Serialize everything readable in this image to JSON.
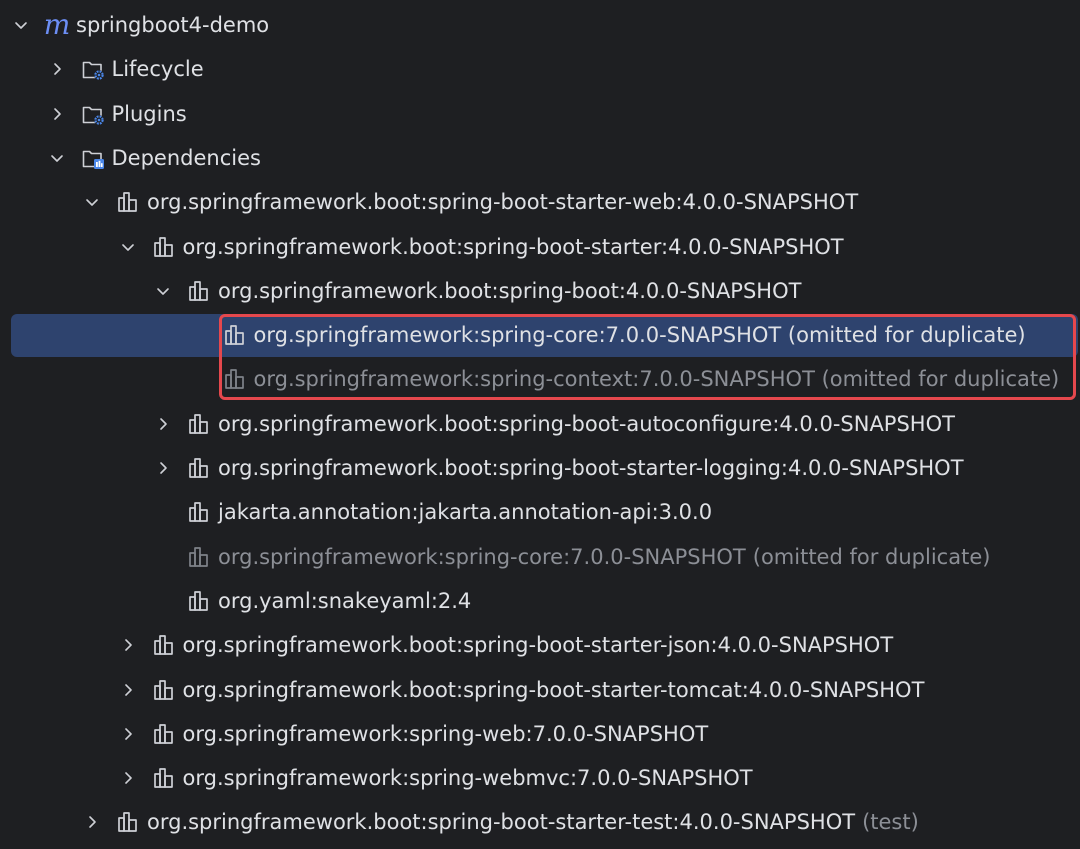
{
  "tree": [
    {
      "id": "root",
      "depth": 0,
      "arrow": "expanded",
      "icon": "maven-module-icon",
      "text": "springboot4-demo",
      "suffix": "",
      "dim": false,
      "selected": false
    },
    {
      "id": "lifecycle",
      "depth": 1,
      "arrow": "collapsed",
      "icon": "lifecycle-folder-icon",
      "text": "Lifecycle",
      "suffix": "",
      "dim": false,
      "selected": false
    },
    {
      "id": "plugins",
      "depth": 1,
      "arrow": "collapsed",
      "icon": "plugins-folder-icon",
      "text": "Plugins",
      "suffix": "",
      "dim": false,
      "selected": false
    },
    {
      "id": "dependencies",
      "depth": 1,
      "arrow": "expanded",
      "icon": "dependencies-folder-icon",
      "text": "Dependencies",
      "suffix": "",
      "dim": false,
      "selected": false
    },
    {
      "id": "starter-web",
      "depth": 2,
      "arrow": "expanded",
      "icon": "library-icon",
      "text": "org.springframework.boot:spring-boot-starter-web:4.0.0-SNAPSHOT",
      "suffix": "",
      "dim": false,
      "selected": false
    },
    {
      "id": "starter",
      "depth": 3,
      "arrow": "expanded",
      "icon": "library-icon",
      "text": "org.springframework.boot:spring-boot-starter:4.0.0-SNAPSHOT",
      "suffix": "",
      "dim": false,
      "selected": false
    },
    {
      "id": "boot",
      "depth": 4,
      "arrow": "expanded",
      "icon": "library-icon",
      "text": "org.springframework.boot:spring-boot:4.0.0-SNAPSHOT",
      "suffix": "",
      "dim": false,
      "selected": false
    },
    {
      "id": "core-dup",
      "depth": 5,
      "arrow": "none",
      "icon": "library-icon",
      "text": "org.springframework:spring-core:7.0.0-SNAPSHOT (omitted for duplicate)",
      "suffix": "",
      "dim": false,
      "selected": true
    },
    {
      "id": "context-dup",
      "depth": 5,
      "arrow": "none",
      "icon": "library-icon",
      "text": "org.springframework:spring-context:7.0.0-SNAPSHOT (omitted for duplicate)",
      "suffix": "",
      "dim": true,
      "selected": false
    },
    {
      "id": "autoconfigure",
      "depth": 4,
      "arrow": "collapsed",
      "icon": "library-icon",
      "text": "org.springframework.boot:spring-boot-autoconfigure:4.0.0-SNAPSHOT",
      "suffix": "",
      "dim": false,
      "selected": false
    },
    {
      "id": "starter-logging",
      "depth": 4,
      "arrow": "collapsed",
      "icon": "library-icon",
      "text": "org.springframework.boot:spring-boot-starter-logging:4.0.0-SNAPSHOT",
      "suffix": "",
      "dim": false,
      "selected": false
    },
    {
      "id": "jakarta",
      "depth": 4,
      "arrow": "none",
      "icon": "library-icon",
      "text": "jakarta.annotation:jakarta.annotation-api:3.0.0",
      "suffix": "",
      "dim": false,
      "selected": false
    },
    {
      "id": "core-dup-2",
      "depth": 4,
      "arrow": "none",
      "icon": "library-icon",
      "text": "org.springframework:spring-core:7.0.0-SNAPSHOT",
      "suffix": "(omitted for duplicate)",
      "dim": true,
      "selected": false
    },
    {
      "id": "snakeyaml",
      "depth": 4,
      "arrow": "none",
      "icon": "library-icon",
      "text": "org.yaml:snakeyaml:2.4",
      "suffix": "",
      "dim": false,
      "selected": false
    },
    {
      "id": "starter-json",
      "depth": 3,
      "arrow": "collapsed",
      "icon": "library-icon",
      "text": "org.springframework.boot:spring-boot-starter-json:4.0.0-SNAPSHOT",
      "suffix": "",
      "dim": false,
      "selected": false
    },
    {
      "id": "starter-tomcat",
      "depth": 3,
      "arrow": "collapsed",
      "icon": "library-icon",
      "text": "org.springframework.boot:spring-boot-starter-tomcat:4.0.0-SNAPSHOT",
      "suffix": "",
      "dim": false,
      "selected": false
    },
    {
      "id": "spring-web",
      "depth": 3,
      "arrow": "collapsed",
      "icon": "library-icon",
      "text": "org.springframework:spring-web:7.0.0-SNAPSHOT",
      "suffix": "",
      "dim": false,
      "selected": false
    },
    {
      "id": "spring-webmvc",
      "depth": 3,
      "arrow": "collapsed",
      "icon": "library-icon",
      "text": "org.springframework:spring-webmvc:7.0.0-SNAPSHOT",
      "suffix": "",
      "dim": false,
      "selected": false
    },
    {
      "id": "starter-test",
      "depth": 2,
      "arrow": "collapsed",
      "icon": "library-icon",
      "text": "org.springframework.boot:spring-boot-starter-test:4.0.0-SNAPSHOT",
      "suffix": "(test)",
      "dim": false,
      "selected": false
    }
  ],
  "logo_glyph": "m",
  "colors": {
    "background": "#1e1f22",
    "selection": "#2e436e",
    "text": "#dfe1e5",
    "dim_text": "#8c8f96",
    "highlight_border": "#e5484d",
    "maven_blue": "#6c8ef4",
    "gear_blue": "#4a86e8"
  }
}
